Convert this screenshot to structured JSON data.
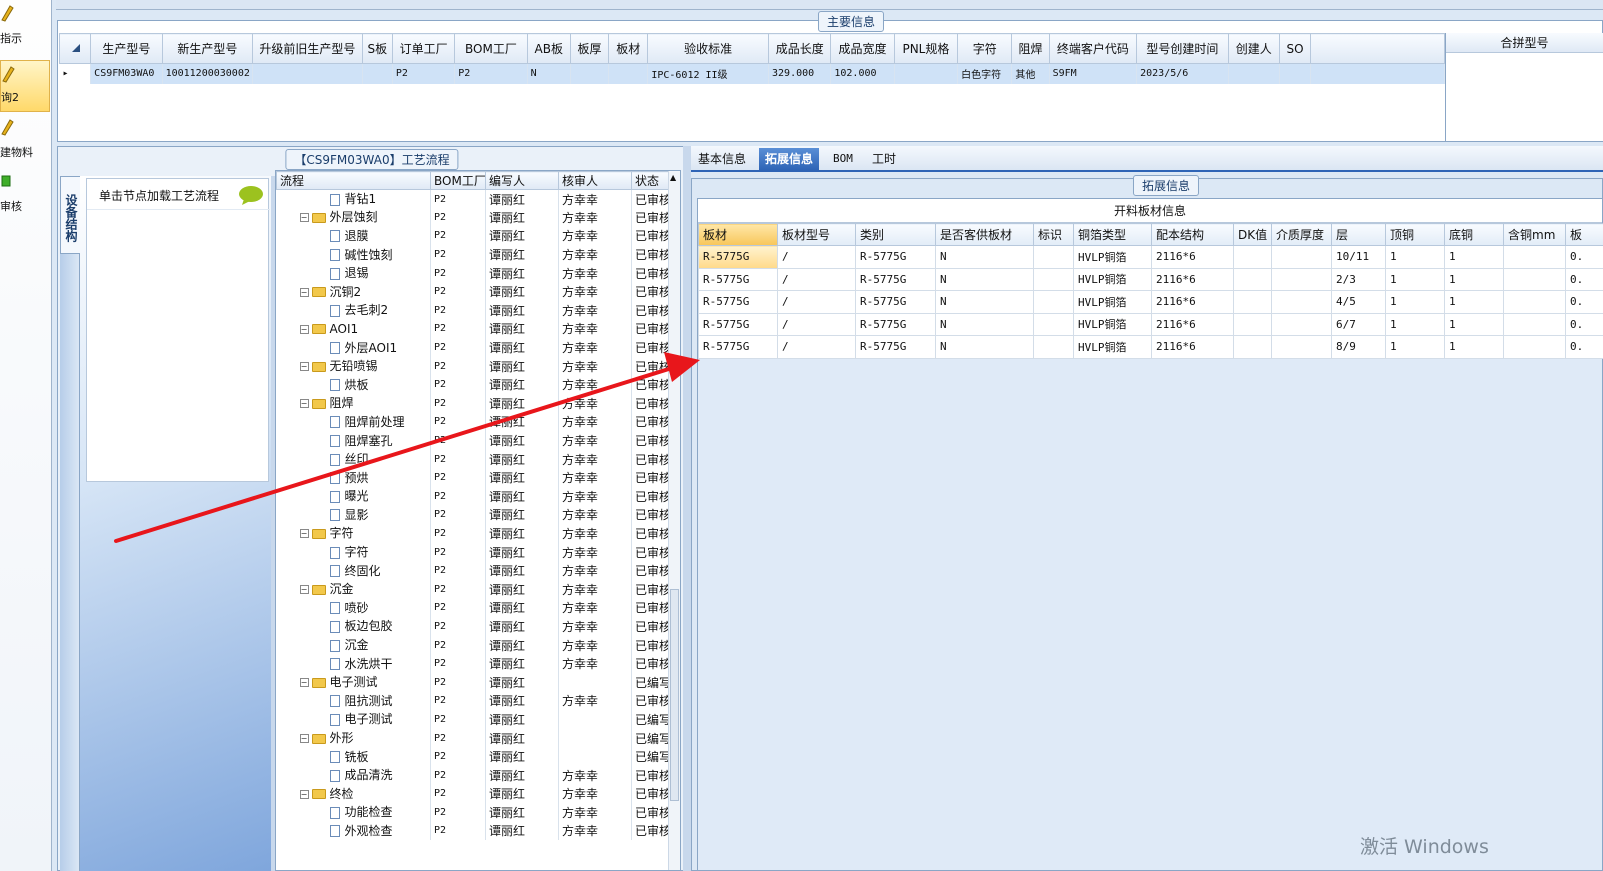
{
  "nav": {
    "items": [
      {
        "label": "指示",
        "icon": "pencil-icon",
        "active": false
      },
      {
        "label": "询2",
        "icon": "pencil-icon",
        "active": true
      },
      {
        "label": "建物料",
        "icon": "pencil-icon",
        "active": false
      },
      {
        "label": "审核",
        "icon": "green-check-icon",
        "active": false
      }
    ]
  },
  "main_info": {
    "title": "主要信息",
    "columns": [
      "生产型号",
      "新生产型号",
      "升级前旧生产型号",
      "S板",
      "订单工厂",
      "BOM工厂",
      "AB板",
      "板厚",
      "板材",
      "验收标准",
      "成品长度",
      "成品宽度",
      "PNL规格",
      "字符",
      "阻焊",
      "终端客户代码",
      "型号创建时间",
      "创建人",
      "SO"
    ],
    "row": [
      "CS9FM03WA0",
      "10011200030002",
      "",
      "",
      "P2",
      "P2",
      "N",
      "",
      "",
      "IPC-6012 II级",
      "329.000",
      "102.000",
      "",
      "白色字符",
      "其他",
      "S9FM",
      "2023/5/6",
      "",
      ""
    ],
    "side_column": "合拼型号"
  },
  "flow_panel": {
    "title": "【CS9FM03WA0】工艺流程",
    "side_tab": "设备结构",
    "hint": "单击节点加载工艺流程",
    "columns": [
      "流程",
      "BOM工厂",
      "编写人",
      "核审人",
      "状态"
    ],
    "rows": [
      {
        "name": "背钻1",
        "level": 2,
        "type": "doc",
        "factory": "P2",
        "writer": "谭丽红",
        "reviewer": "方幸幸",
        "status": "已审核"
      },
      {
        "name": "外层蚀刻",
        "level": 1,
        "type": "folder",
        "factory": "P2",
        "writer": "谭丽红",
        "reviewer": "方幸幸",
        "status": "已审核"
      },
      {
        "name": "退膜",
        "level": 2,
        "type": "doc",
        "factory": "P2",
        "writer": "谭丽红",
        "reviewer": "方幸幸",
        "status": "已审核"
      },
      {
        "name": "碱性蚀刻",
        "level": 2,
        "type": "doc",
        "factory": "P2",
        "writer": "谭丽红",
        "reviewer": "方幸幸",
        "status": "已审核"
      },
      {
        "name": "退锡",
        "level": 2,
        "type": "doc",
        "factory": "P2",
        "writer": "谭丽红",
        "reviewer": "方幸幸",
        "status": "已审核"
      },
      {
        "name": "沉铜2",
        "level": 1,
        "type": "folder",
        "factory": "P2",
        "writer": "谭丽红",
        "reviewer": "方幸幸",
        "status": "已审核"
      },
      {
        "name": "去毛刺2",
        "level": 2,
        "type": "doc",
        "factory": "P2",
        "writer": "谭丽红",
        "reviewer": "方幸幸",
        "status": "已审核"
      },
      {
        "name": "AOI1",
        "level": 1,
        "type": "folder",
        "factory": "P2",
        "writer": "谭丽红",
        "reviewer": "方幸幸",
        "status": "已审核"
      },
      {
        "name": "外层AOI1",
        "level": 2,
        "type": "doc",
        "factory": "P2",
        "writer": "谭丽红",
        "reviewer": "方幸幸",
        "status": "已审核"
      },
      {
        "name": "无铅喷锡",
        "level": 1,
        "type": "folder",
        "factory": "P2",
        "writer": "谭丽红",
        "reviewer": "方幸幸",
        "status": "已审核"
      },
      {
        "name": "烘板",
        "level": 2,
        "type": "doc",
        "factory": "P2",
        "writer": "谭丽红",
        "reviewer": "方幸幸",
        "status": "已审核"
      },
      {
        "name": "阻焊",
        "level": 1,
        "type": "folder",
        "factory": "P2",
        "writer": "谭丽红",
        "reviewer": "方幸幸",
        "status": "已审核"
      },
      {
        "name": "阻焊前处理",
        "level": 2,
        "type": "doc",
        "factory": "P2",
        "writer": "谭丽红",
        "reviewer": "方幸幸",
        "status": "已审核"
      },
      {
        "name": "阻焊塞孔",
        "level": 2,
        "type": "doc",
        "factory": "P2",
        "writer": "谭丽红",
        "reviewer": "方幸幸",
        "status": "已审核"
      },
      {
        "name": "丝印",
        "level": 2,
        "type": "doc",
        "factory": "P2",
        "writer": "谭丽红",
        "reviewer": "方幸幸",
        "status": "已审核"
      },
      {
        "name": "预烘",
        "level": 2,
        "type": "doc",
        "factory": "P2",
        "writer": "谭丽红",
        "reviewer": "方幸幸",
        "status": "已审核"
      },
      {
        "name": "曝光",
        "level": 2,
        "type": "doc",
        "factory": "P2",
        "writer": "谭丽红",
        "reviewer": "方幸幸",
        "status": "已审核"
      },
      {
        "name": "显影",
        "level": 2,
        "type": "doc",
        "factory": "P2",
        "writer": "谭丽红",
        "reviewer": "方幸幸",
        "status": "已审核"
      },
      {
        "name": "字符",
        "level": 1,
        "type": "folder",
        "factory": "P2",
        "writer": "谭丽红",
        "reviewer": "方幸幸",
        "status": "已审核"
      },
      {
        "name": "字符",
        "level": 2,
        "type": "doc",
        "factory": "P2",
        "writer": "谭丽红",
        "reviewer": "方幸幸",
        "status": "已审核"
      },
      {
        "name": "终固化",
        "level": 2,
        "type": "doc",
        "factory": "P2",
        "writer": "谭丽红",
        "reviewer": "方幸幸",
        "status": "已审核"
      },
      {
        "name": "沉金",
        "level": 1,
        "type": "folder",
        "factory": "P2",
        "writer": "谭丽红",
        "reviewer": "方幸幸",
        "status": "已审核"
      },
      {
        "name": "喷砂",
        "level": 2,
        "type": "doc",
        "factory": "P2",
        "writer": "谭丽红",
        "reviewer": "方幸幸",
        "status": "已审核"
      },
      {
        "name": "板边包胶",
        "level": 2,
        "type": "doc",
        "factory": "P2",
        "writer": "谭丽红",
        "reviewer": "方幸幸",
        "status": "已审核"
      },
      {
        "name": "沉金",
        "level": 2,
        "type": "doc",
        "factory": "P2",
        "writer": "谭丽红",
        "reviewer": "方幸幸",
        "status": "已审核"
      },
      {
        "name": "水洗烘干",
        "level": 2,
        "type": "doc",
        "factory": "P2",
        "writer": "谭丽红",
        "reviewer": "方幸幸",
        "status": "已审核"
      },
      {
        "name": "电子测试",
        "level": 1,
        "type": "folder",
        "factory": "P2",
        "writer": "谭丽红",
        "reviewer": "",
        "status": "已编写"
      },
      {
        "name": "阻抗测试",
        "level": 2,
        "type": "doc",
        "factory": "P2",
        "writer": "谭丽红",
        "reviewer": "方幸幸",
        "status": "已审核"
      },
      {
        "name": "电子测试",
        "level": 2,
        "type": "doc",
        "factory": "P2",
        "writer": "谭丽红",
        "reviewer": "",
        "status": "已编写"
      },
      {
        "name": "外形",
        "level": 1,
        "type": "folder",
        "factory": "P2",
        "writer": "谭丽红",
        "reviewer": "",
        "status": "已编写"
      },
      {
        "name": "铣板",
        "level": 2,
        "type": "doc",
        "factory": "P2",
        "writer": "谭丽红",
        "reviewer": "",
        "status": "已编写"
      },
      {
        "name": "成品清洗",
        "level": 2,
        "type": "doc",
        "factory": "P2",
        "writer": "谭丽红",
        "reviewer": "方幸幸",
        "status": "已审核"
      },
      {
        "name": "终检",
        "level": 1,
        "type": "folder",
        "factory": "P2",
        "writer": "谭丽红",
        "reviewer": "方幸幸",
        "status": "已审核"
      },
      {
        "name": "功能检查",
        "level": 2,
        "type": "doc",
        "factory": "P2",
        "writer": "谭丽红",
        "reviewer": "方幸幸",
        "status": "已审核"
      },
      {
        "name": "外观检查",
        "level": 2,
        "type": "doc",
        "factory": "P2",
        "writer": "谭丽红",
        "reviewer": "方幸幸",
        "status": "已审核"
      }
    ]
  },
  "tabs": [
    {
      "label": "基本信息",
      "active": false
    },
    {
      "label": "拓展信息",
      "active": true
    },
    {
      "label": "BOM",
      "active": false
    },
    {
      "label": "工时",
      "active": false
    }
  ],
  "ext_panel": {
    "title": "拓展信息",
    "grid_title": "开料板材信息",
    "columns": [
      "板材",
      "板材型号",
      "类别",
      "是否客供板材",
      "标识",
      "铜箔类型",
      "配本结构",
      "DK值",
      "介质厚度",
      "层",
      "顶铜",
      "底铜",
      "含铜mm",
      "板"
    ],
    "rows": [
      [
        "R-5775G",
        "/",
        "R-5775G",
        "N",
        "",
        "HVLP铜箔",
        "2116*6",
        "",
        "",
        "10/11",
        "1",
        "1",
        "",
        "0."
      ],
      [
        "R-5775G",
        "/",
        "R-5775G",
        "N",
        "",
        "HVLP铜箔",
        "2116*6",
        "",
        "",
        "2/3",
        "1",
        "1",
        "",
        "0."
      ],
      [
        "R-5775G",
        "/",
        "R-5775G",
        "N",
        "",
        "HVLP铜箔",
        "2116*6",
        "",
        "",
        "4/5",
        "1",
        "1",
        "",
        "0."
      ],
      [
        "R-5775G",
        "/",
        "R-5775G",
        "N",
        "",
        "HVLP铜箔",
        "2116*6",
        "",
        "",
        "6/7",
        "1",
        "1",
        "",
        "0."
      ],
      [
        "R-5775G",
        "/",
        "R-5775G",
        "N",
        "",
        "HVLP铜箔",
        "2116*6",
        "",
        "",
        "8/9",
        "1",
        "1",
        "",
        "0."
      ]
    ]
  },
  "watermark": "激活 Windows",
  "colors": {
    "accent": "#2e64b6",
    "arrow": "#e8161b",
    "selection": "#cfe2f7"
  }
}
